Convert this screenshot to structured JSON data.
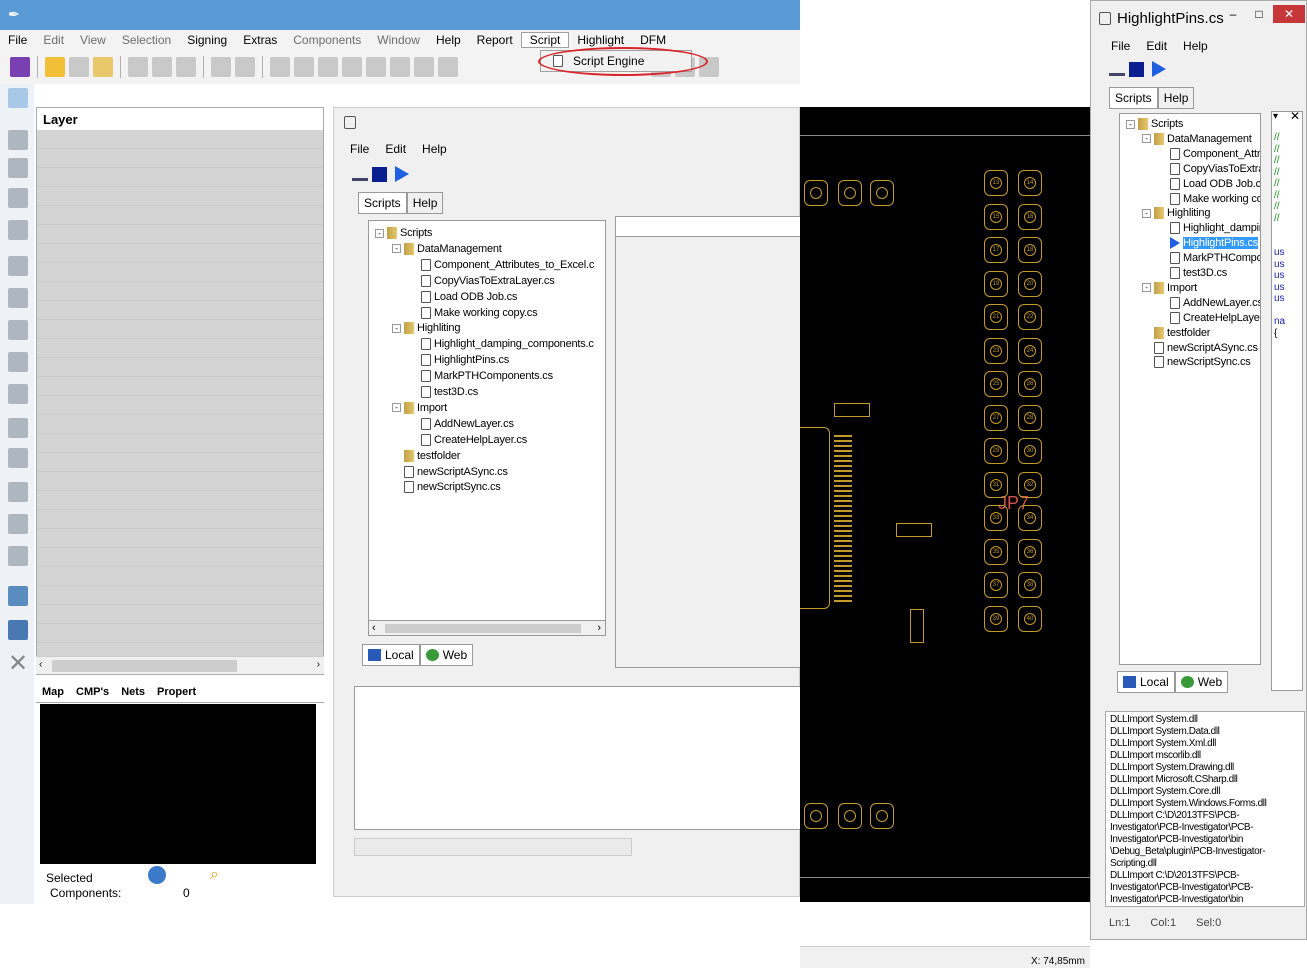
{
  "menu": {
    "items": [
      {
        "label": "File",
        "dis": false
      },
      {
        "label": "Edit",
        "dis": true
      },
      {
        "label": "View",
        "dis": true
      },
      {
        "label": "Selection",
        "dis": true
      },
      {
        "label": "Signing",
        "dis": false
      },
      {
        "label": "Extras",
        "dis": false
      },
      {
        "label": "Components",
        "dis": true
      },
      {
        "label": "Window",
        "dis": true
      },
      {
        "label": "Help",
        "dis": false
      },
      {
        "label": "Report",
        "dis": false
      },
      {
        "label": "Script",
        "dis": false
      },
      {
        "label": "Highlight",
        "dis": false
      },
      {
        "label": "DFM",
        "dis": false
      }
    ],
    "popup": "Script Engine"
  },
  "layer": {
    "title": "Layer"
  },
  "bottom_tabs": [
    "Map",
    "CMP's",
    "Nets",
    "Propert"
  ],
  "selected": {
    "title": "Selected",
    "components_label": "Components:",
    "components_value": "0"
  },
  "editor": {
    "menu": [
      "File",
      "Edit",
      "Help"
    ],
    "tabs": [
      "Scripts",
      "Help"
    ],
    "bottom_tabs": [
      "Local",
      "Web"
    ]
  },
  "tree": [
    {
      "label": "Scripts",
      "lvl": 0,
      "kind": "folder",
      "ex": "-"
    },
    {
      "label": "DataManagement",
      "lvl": 1,
      "kind": "folder",
      "ex": "-"
    },
    {
      "label": "Component_Attributes_to_Excel.c",
      "lvl": 2,
      "kind": "script"
    },
    {
      "label": "CopyViasToExtraLayer.cs",
      "lvl": 2,
      "kind": "script"
    },
    {
      "label": "Load ODB Job.cs",
      "lvl": 2,
      "kind": "script"
    },
    {
      "label": "Make working copy.cs",
      "lvl": 2,
      "kind": "script"
    },
    {
      "label": "Highliting",
      "lvl": 1,
      "kind": "folder",
      "ex": "-"
    },
    {
      "label": "Highlight_damping_components.c",
      "lvl": 2,
      "kind": "script"
    },
    {
      "label": "HighlightPins.cs",
      "lvl": 2,
      "kind": "script"
    },
    {
      "label": "MarkPTHComponents.cs",
      "lvl": 2,
      "kind": "script"
    },
    {
      "label": "test3D.cs",
      "lvl": 2,
      "kind": "script"
    },
    {
      "label": "Import",
      "lvl": 1,
      "kind": "folder",
      "ex": "-"
    },
    {
      "label": "AddNewLayer.cs",
      "lvl": 2,
      "kind": "script"
    },
    {
      "label": "CreateHelpLayer.cs",
      "lvl": 2,
      "kind": "script"
    },
    {
      "label": "testfolder",
      "lvl": 1,
      "kind": "folder"
    },
    {
      "label": "newScriptASync.cs",
      "lvl": 1,
      "kind": "script"
    },
    {
      "label": "newScriptSync.cs",
      "lvl": 1,
      "kind": "script"
    }
  ],
  "right": {
    "title": "HighlightPins.cs",
    "menu": [
      "File",
      "Edit",
      "Help"
    ],
    "tabs": [
      "Scripts",
      "Help"
    ],
    "bottom_tabs": [
      "Local",
      "Web"
    ],
    "tree": [
      {
        "label": "Scripts",
        "lvl": 0,
        "kind": "folder",
        "ex": "-"
      },
      {
        "label": "DataManagement",
        "lvl": 1,
        "kind": "folder",
        "ex": "-"
      },
      {
        "label": "Component_Attribu",
        "lvl": 2,
        "kind": "script"
      },
      {
        "label": "CopyViasToExtraL",
        "lvl": 2,
        "kind": "script"
      },
      {
        "label": "Load ODB Job.cs",
        "lvl": 2,
        "kind": "script"
      },
      {
        "label": "Make working cop",
        "lvl": 2,
        "kind": "script"
      },
      {
        "label": "Highliting",
        "lvl": 1,
        "kind": "folder",
        "ex": "-"
      },
      {
        "label": "Highlight_damping",
        "lvl": 2,
        "kind": "script"
      },
      {
        "label": "HighlightPins.cs",
        "lvl": 2,
        "kind": "script",
        "sel": true
      },
      {
        "label": "MarkPTHCompon",
        "lvl": 2,
        "kind": "script"
      },
      {
        "label": "test3D.cs",
        "lvl": 2,
        "kind": "script"
      },
      {
        "label": "Import",
        "lvl": 1,
        "kind": "folder",
        "ex": "-"
      },
      {
        "label": "AddNewLayer.cs",
        "lvl": 2,
        "kind": "script"
      },
      {
        "label": "CreateHelpLayer.c",
        "lvl": 2,
        "kind": "script"
      },
      {
        "label": "testfolder",
        "lvl": 1,
        "kind": "folder"
      },
      {
        "label": "newScriptASync.cs",
        "lvl": 1,
        "kind": "script"
      },
      {
        "label": "newScriptSync.cs",
        "lvl": 1,
        "kind": "script"
      }
    ],
    "code": [
      "//",
      "//",
      "//",
      "//",
      "//",
      "//",
      "//",
      "//",
      "",
      "",
      "us",
      "us",
      "us",
      "us",
      "us",
      "",
      "na",
      "{"
    ],
    "console": [
      "DLLImport System.dll",
      "DLLImport System.Data.dll",
      "DLLImport System.Xml.dll",
      "DLLImport mscorlib.dll",
      "DLLImport System.Drawing.dll",
      "DLLImport Microsoft.CSharp.dll",
      "DLLImport System.Core.dll",
      "DLLImport System.Windows.Forms.dll",
      "DLLImport C:\\D\\2013TFS\\PCB-",
      "Investigator\\PCB-Investigator\\PCB-",
      "Investigator\\PCB-Investigator\\bin",
      "\\Debug_Beta\\plugin\\PCB-Investigator-",
      "Scripting.dll",
      "DLLImport C:\\D\\2013TFS\\PCB-",
      "Investigator\\PCB-Investigator\\PCB-",
      "Investigator\\PCB-Investigator\\bin"
    ],
    "status": {
      "ln": "Ln:1",
      "col": "Col:1",
      "sel": "Sel:0"
    }
  },
  "pcb": {
    "label": "JP7",
    "left_pads": [
      "13",
      "14",
      "15",
      "16",
      "17",
      "18",
      "19",
      "20",
      "21",
      "22",
      "23",
      "24",
      "25",
      "26",
      "27",
      "28",
      "29",
      "30",
      "31",
      "32",
      "33",
      "34",
      "35",
      "36",
      "37",
      "38",
      "39",
      "40"
    ],
    "coord": "X: 74,85mm"
  },
  "colors": {
    "titlebar": "#5b9bd5",
    "pcb_gold": "#c49a2a",
    "highlight": "#d9262b",
    "select": "#3399ff"
  }
}
